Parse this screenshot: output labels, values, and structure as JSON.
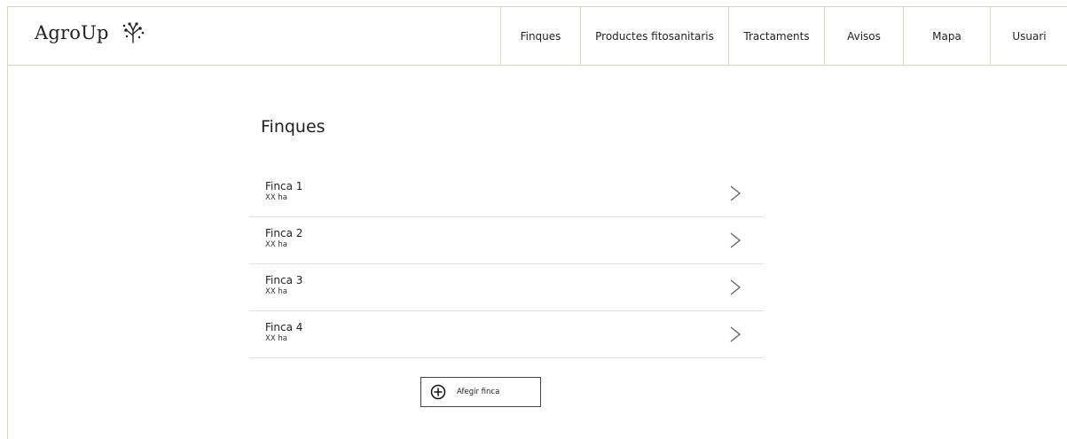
{
  "brand": {
    "name": "AgroUp",
    "logo_icon": "sprout-icon"
  },
  "nav": {
    "items": [
      {
        "label": "Finques"
      },
      {
        "label": "Productes fitosanitaris"
      },
      {
        "label": "Tractaments"
      },
      {
        "label": "Avisos"
      },
      {
        "label": "Mapa"
      },
      {
        "label": "Usuari"
      }
    ]
  },
  "main": {
    "title": "Finques",
    "farms": [
      {
        "name": "Finca 1",
        "area": "XX ha",
        "icon": "chevron-right-icon"
      },
      {
        "name": "Finca 2",
        "area": "XX ha",
        "icon": "chevron-right-icon"
      },
      {
        "name": "Finca 3",
        "area": "XX ha",
        "icon": "chevron-right-icon"
      },
      {
        "name": "Finca 4",
        "area": "XX ha",
        "icon": "chevron-right-icon"
      }
    ],
    "add_button": {
      "label": "Afegir finca",
      "icon": "plus-circle-icon"
    }
  },
  "colors": {
    "border": "#dcd8c9",
    "divider": "#e2e2e2",
    "text": "#222222"
  }
}
